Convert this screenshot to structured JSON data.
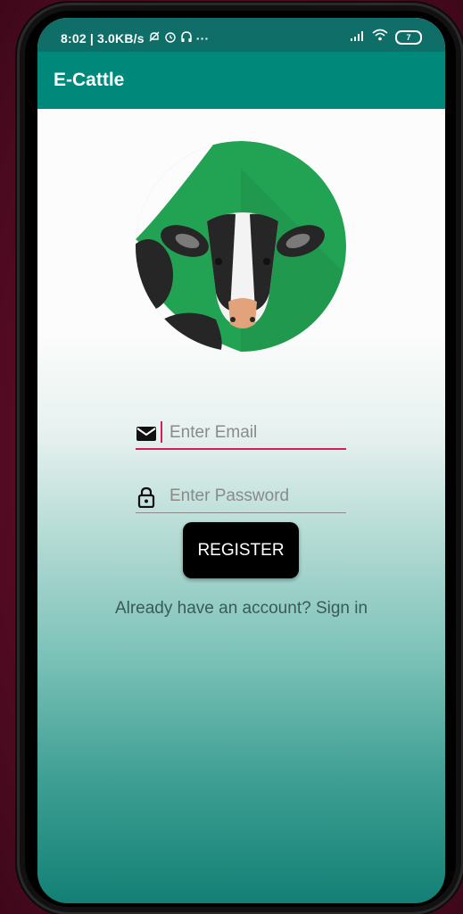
{
  "status_bar": {
    "time": "8:02",
    "network_speed": "3.0KB/s",
    "more": "···",
    "battery": "7"
  },
  "app_bar": {
    "title": "E-Cattle"
  },
  "form": {
    "email_placeholder": "Enter Email",
    "password_placeholder": "Enter Password",
    "register_label": "REGISTER",
    "signin_text": "Already  have an account? Sign in"
  },
  "colors": {
    "app_bar": "#00897b",
    "status_bar": "#0f6e67",
    "accent": "#d81b60",
    "logo_green": "#22a354"
  },
  "icons": [
    "mail-icon",
    "lock-icon",
    "wifi-icon",
    "signal-icon",
    "alarm-icon",
    "headphones-icon",
    "cattle-logo"
  ]
}
